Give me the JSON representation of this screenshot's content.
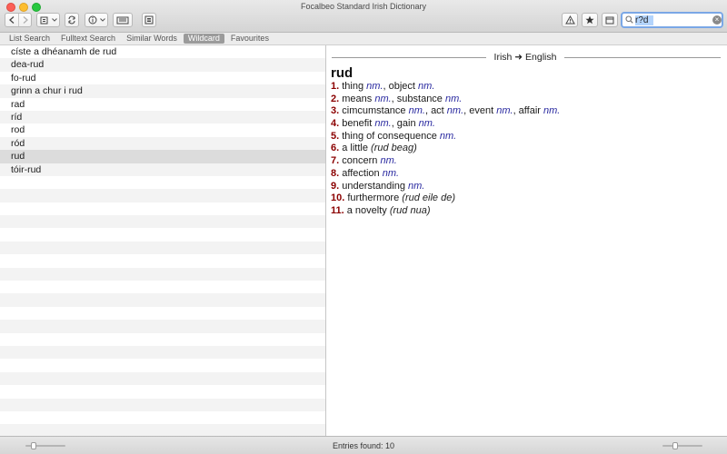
{
  "window": {
    "title": "Focalbeo Standard Irish Dictionary"
  },
  "toolbar": {
    "back_icon": "chevron-left-icon",
    "forward_icon": "chevron-right-icon",
    "alert_icon": "warning-triangle-icon",
    "favourite_icon": "star-icon"
  },
  "search": {
    "value": "r?d",
    "clear_icon": "clear-circle-icon"
  },
  "tabs": [
    {
      "label": "List Search"
    },
    {
      "label": "Fulltext Search"
    },
    {
      "label": "Similar Words"
    },
    {
      "label": "Wildcard",
      "active": true
    },
    {
      "label": "Favourites"
    }
  ],
  "results": [
    "císte a dhéanamh de rud",
    "dea-rud",
    "fo-rud",
    "grinn a chur i rud",
    "rad",
    "ríd",
    "rod",
    "ród",
    "rud",
    "tóir-rud"
  ],
  "selected_index": 8,
  "entry": {
    "direction": "Irish ➜ English",
    "headword": "rud",
    "senses": [
      {
        "num": "1.",
        "parts": [
          [
            "t",
            "thing "
          ],
          [
            "g",
            "nm."
          ],
          [
            "t",
            ", object "
          ],
          [
            "g",
            "nm."
          ]
        ]
      },
      {
        "num": "2.",
        "parts": [
          [
            "t",
            "means "
          ],
          [
            "g",
            "nm."
          ],
          [
            "t",
            ", substance "
          ],
          [
            "g",
            "nm."
          ]
        ]
      },
      {
        "num": "3.",
        "parts": [
          [
            "t",
            "cimcumstance "
          ],
          [
            "g",
            "nm."
          ],
          [
            "t",
            ", act "
          ],
          [
            "g",
            "nm."
          ],
          [
            "t",
            ", event "
          ],
          [
            "g",
            "nm."
          ],
          [
            "t",
            ", affair "
          ],
          [
            "g",
            "nm."
          ]
        ]
      },
      {
        "num": "4.",
        "parts": [
          [
            "t",
            "benefit "
          ],
          [
            "g",
            "nm."
          ],
          [
            "t",
            ", gain "
          ],
          [
            "g",
            "nm."
          ]
        ]
      },
      {
        "num": "5.",
        "parts": [
          [
            "t",
            "thing of consequence "
          ],
          [
            "g",
            "nm."
          ]
        ]
      },
      {
        "num": "6.",
        "parts": [
          [
            "t",
            "a little "
          ],
          [
            "e",
            "(rud beag)"
          ]
        ]
      },
      {
        "num": "7.",
        "parts": [
          [
            "t",
            "concern "
          ],
          [
            "g",
            "nm."
          ]
        ]
      },
      {
        "num": "8.",
        "parts": [
          [
            "t",
            "affection "
          ],
          [
            "g",
            "nm."
          ]
        ]
      },
      {
        "num": "9.",
        "parts": [
          [
            "t",
            "understanding "
          ],
          [
            "g",
            "nm."
          ]
        ]
      },
      {
        "num": "10.",
        "parts": [
          [
            "t",
            "furthermore "
          ],
          [
            "e",
            "(rud eile de)"
          ]
        ]
      },
      {
        "num": "11.",
        "parts": [
          [
            "t",
            "a novelty "
          ],
          [
            "e",
            "(rud nua)"
          ]
        ]
      }
    ]
  },
  "status": {
    "text": "Entries found: 10"
  },
  "sliders": {
    "left_level": 0.15,
    "right_level": 0.3
  }
}
